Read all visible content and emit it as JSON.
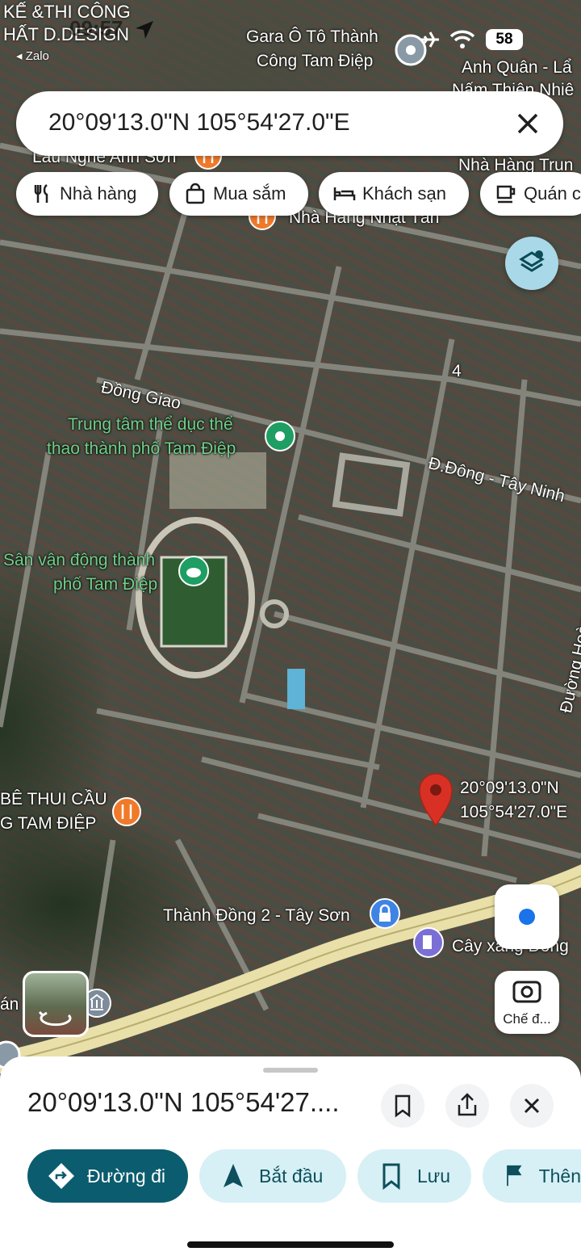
{
  "status_bar": {
    "time": "09:57",
    "back_app": "◂ Zalo",
    "battery": "58",
    "overlay_text_1": "KẾ &THI CÔNG",
    "overlay_text_2": "HẤT D.DESIGN"
  },
  "search": {
    "query": "20°09'13.0\"N 105°54'27.0\"E"
  },
  "chips": [
    {
      "label": "Nhà hàng",
      "icon": "fork-knife-icon"
    },
    {
      "label": "Mua sắm",
      "icon": "shopping-bag-icon"
    },
    {
      "label": "Khách sạn",
      "icon": "bed-icon"
    },
    {
      "label": "Quán c",
      "icon": "coffee-cup-icon"
    }
  ],
  "map_labels": {
    "gara_1": "Gara Ô Tô Thành",
    "gara_2": "Công Tam Điệp",
    "anh_quan": "Anh Quân - Lẩ",
    "nam": "Nấm Thiên Nhiê",
    "lau": "Lẩu Nghé Anh Sơn",
    "nha_hang_trung": "Nhà Hàng Trun",
    "nha_hang_nhat": "Nhà Hàng Nhật Tân",
    "dong_giao": "Đồng Giao",
    "ttdt_1": "Trung tâm thể dục thể",
    "ttdt_2": "thao thành phố Tam Điệp",
    "road_4": "4",
    "dong_tay_ninh": "Đ.Đông - Tây Ninh",
    "svd_1": "Sân vận động thành",
    "svd_2": "phố Tam Điệp",
    "hoang_quoc": "Đường Hoàng Quốc",
    "pin_1": "20°09'13.0\"N",
    "pin_2": "105°54'27.0\"E",
    "be_thui_1": "BÊ THUI CẦU",
    "be_thui_2": "G TAM ĐIỆP",
    "thanh_dong": "Thành Đồng 2 - Tây Sơn",
    "cay_xang": "Cây xăng Đông",
    "an": "án"
  },
  "camera_button": {
    "label": "Chế đ..."
  },
  "sheet": {
    "title": "20°09'13.0\"N 105°54'27...."
  },
  "actions": [
    {
      "label": "Đường đi",
      "icon": "directions-icon"
    },
    {
      "label": "Bắt đầu",
      "icon": "navigation-arrow-icon"
    },
    {
      "label": "Lưu",
      "icon": "bookmark-icon"
    },
    {
      "label": "Thên",
      "icon": "flag-icon"
    }
  ],
  "colors": {
    "primary": "#0b5c6e",
    "secondary_bg": "#d6f0f5",
    "pin": "#d93025",
    "highway": "#e9dfa8"
  }
}
